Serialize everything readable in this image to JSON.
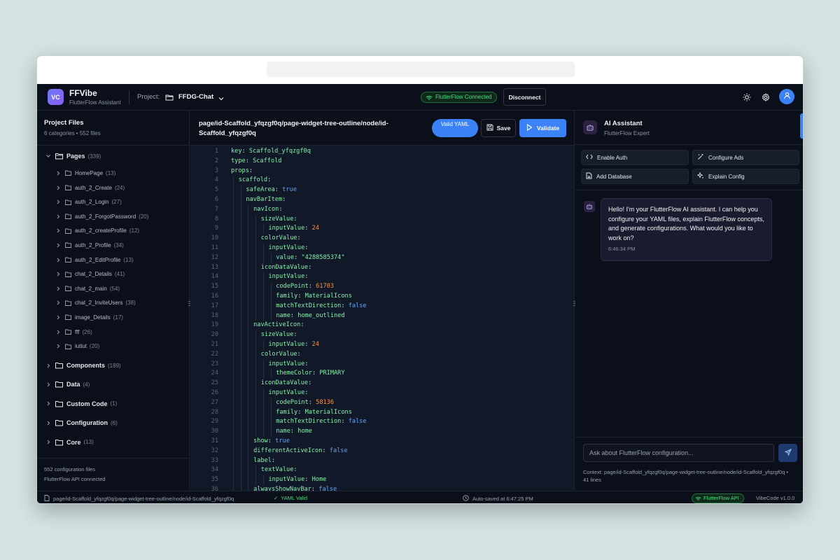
{
  "app": {
    "logo_text": "VC",
    "name": "FFVibe",
    "subtitle": "FlutterFlow Assistant",
    "project_label": "Project:",
    "project_name": "FFDG-Chat",
    "connection_status": "FlutterFlow Connected",
    "disconnect_label": "Disconnect"
  },
  "sidebar": {
    "title": "Project Files",
    "subtitle": "6 categories • 552 files",
    "tree": [
      {
        "label": "Pages",
        "count": "(339)",
        "level": 0,
        "expanded": true
      },
      {
        "label": "HomePage",
        "count": "(13)",
        "level": 1
      },
      {
        "label": "auth_2_Create",
        "count": "(24)",
        "level": 1
      },
      {
        "label": "auth_2_Login",
        "count": "(27)",
        "level": 1
      },
      {
        "label": "auth_2_ForgotPassword",
        "count": "(20)",
        "level": 1
      },
      {
        "label": "auth_2_createProfile",
        "count": "(12)",
        "level": 1
      },
      {
        "label": "auth_2_Profile",
        "count": "(34)",
        "level": 1
      },
      {
        "label": "auth_2_EditProfile",
        "count": "(13)",
        "level": 1
      },
      {
        "label": "chat_2_Details",
        "count": "(41)",
        "level": 1
      },
      {
        "label": "chat_2_main",
        "count": "(54)",
        "level": 1
      },
      {
        "label": "chat_2_InviteUsers",
        "count": "(38)",
        "level": 1
      },
      {
        "label": "image_Details",
        "count": "(17)",
        "level": 1
      },
      {
        "label": "fff",
        "count": "(26)",
        "level": 1
      },
      {
        "label": "iutiut",
        "count": "(20)",
        "level": 1
      },
      {
        "label": "Components",
        "count": "(189)",
        "level": 0
      },
      {
        "label": "Data",
        "count": "(4)",
        "level": 0
      },
      {
        "label": "Custom Code",
        "count": "(1)",
        "level": 0
      },
      {
        "label": "Configuration",
        "count": "(6)",
        "level": 0
      },
      {
        "label": "Core",
        "count": "(13)",
        "level": 0
      }
    ],
    "footer_files": "552 configuration files",
    "footer_api": "FlutterFlow API connected"
  },
  "editor": {
    "path": "page/id-Scaffold_yfqzgf0q/page-widget-tree-outline/node/id-Scaffold_yfqzgf0q",
    "valid_label": "Valid YAML",
    "save_label": "Save",
    "validate_label": "Validate",
    "lines": [
      {
        "n": "1",
        "i": 0,
        "k": "key",
        "v": "Scaffold_yfqzgf0q",
        "t": "str"
      },
      {
        "n": "2",
        "i": 0,
        "k": "type",
        "v": "Scaffold",
        "t": "str"
      },
      {
        "n": "3",
        "i": 0,
        "k": "props",
        "v": "",
        "t": ""
      },
      {
        "n": "4",
        "i": 1,
        "k": "scaffold",
        "v": "",
        "t": ""
      },
      {
        "n": "5",
        "i": 2,
        "k": "safeArea",
        "v": "true",
        "t": "bool"
      },
      {
        "n": "6",
        "i": 2,
        "k": "navBarItem",
        "v": "",
        "t": ""
      },
      {
        "n": "7",
        "i": 3,
        "k": "navIcon",
        "v": "",
        "t": ""
      },
      {
        "n": "8",
        "i": 4,
        "k": "sizeValue",
        "v": "",
        "t": ""
      },
      {
        "n": "9",
        "i": 5,
        "k": "inputValue",
        "v": "24",
        "t": "num"
      },
      {
        "n": "10",
        "i": 4,
        "k": "colorValue",
        "v": "",
        "t": ""
      },
      {
        "n": "11",
        "i": 5,
        "k": "inputValue",
        "v": "",
        "t": ""
      },
      {
        "n": "12",
        "i": 6,
        "k": "value",
        "v": "\"4288585374\"",
        "t": "q"
      },
      {
        "n": "13",
        "i": 4,
        "k": "iconDataValue",
        "v": "",
        "t": ""
      },
      {
        "n": "14",
        "i": 5,
        "k": "inputValue",
        "v": "",
        "t": ""
      },
      {
        "n": "15",
        "i": 6,
        "k": "codePoint",
        "v": "61703",
        "t": "num"
      },
      {
        "n": "16",
        "i": 6,
        "k": "family",
        "v": "MaterialIcons",
        "t": "str"
      },
      {
        "n": "17",
        "i": 6,
        "k": "matchTextDirection",
        "v": "false",
        "t": "bool"
      },
      {
        "n": "18",
        "i": 6,
        "k": "name",
        "v": "home_outlined",
        "t": "str"
      },
      {
        "n": "19",
        "i": 3,
        "k": "navActiveIcon",
        "v": "",
        "t": ""
      },
      {
        "n": "20",
        "i": 4,
        "k": "sizeValue",
        "v": "",
        "t": ""
      },
      {
        "n": "21",
        "i": 5,
        "k": "inputValue",
        "v": "24",
        "t": "num"
      },
      {
        "n": "22",
        "i": 4,
        "k": "colorValue",
        "v": "",
        "t": ""
      },
      {
        "n": "23",
        "i": 5,
        "k": "inputValue",
        "v": "",
        "t": ""
      },
      {
        "n": "24",
        "i": 6,
        "k": "themeColor",
        "v": "PRIMARY",
        "t": "str"
      },
      {
        "n": "25",
        "i": 4,
        "k": "iconDataValue",
        "v": "",
        "t": ""
      },
      {
        "n": "26",
        "i": 5,
        "k": "inputValue",
        "v": "",
        "t": ""
      },
      {
        "n": "27",
        "i": 6,
        "k": "codePoint",
        "v": "58136",
        "t": "num"
      },
      {
        "n": "28",
        "i": 6,
        "k": "family",
        "v": "MaterialIcons",
        "t": "str"
      },
      {
        "n": "29",
        "i": 6,
        "k": "matchTextDirection",
        "v": "false",
        "t": "bool"
      },
      {
        "n": "30",
        "i": 6,
        "k": "name",
        "v": "home",
        "t": "str"
      },
      {
        "n": "31",
        "i": 3,
        "k": "show",
        "v": "true",
        "t": "bool"
      },
      {
        "n": "32",
        "i": 3,
        "k": "differentActiveIcon",
        "v": "false",
        "t": "bool"
      },
      {
        "n": "33",
        "i": 3,
        "k": "label",
        "v": "",
        "t": ""
      },
      {
        "n": "34",
        "i": 4,
        "k": "textValue",
        "v": "",
        "t": ""
      },
      {
        "n": "35",
        "i": 5,
        "k": "inputValue",
        "v": "Home",
        "t": "str"
      },
      {
        "n": "36",
        "i": 3,
        "k": "alwaysShowNavBar",
        "v": "false",
        "t": "bool"
      }
    ]
  },
  "assistant": {
    "title": "AI Assistant",
    "subtitle": "FlutterFlow Expert",
    "quick_actions": [
      "Enable Auth",
      "Configure Ads",
      "Add Database",
      "Explain Config"
    ],
    "message": "Hello! I'm your FlutterFlow AI assistant. I can help you configure your YAML files, explain FlutterFlow concepts, and generate configurations. What would you like to work on?",
    "message_time": "6:46:34 PM",
    "input_placeholder": "Ask about FlutterFlow configuration...",
    "context": "Context: page/id-Scaffold_yfqzgf0q/page-widget-tree-outline/node/id-Scaffold_yfqzgf0q • 41 lines"
  },
  "statusbar": {
    "file": "page/id-Scaffold_yfqzgf0q/page-widget-tree-outline/node/id-Scaffold_yfqzgf0q",
    "valid": "YAML Valid",
    "saved": "Auto-saved at 6:47:25 PM",
    "api": "FlutterFlow API",
    "version": "VibeCode v1.0.0"
  },
  "colors": {
    "accent": "#3b82f6",
    "success": "#4ade80",
    "background": "#0b0f19",
    "editor_bg": "#111827"
  }
}
